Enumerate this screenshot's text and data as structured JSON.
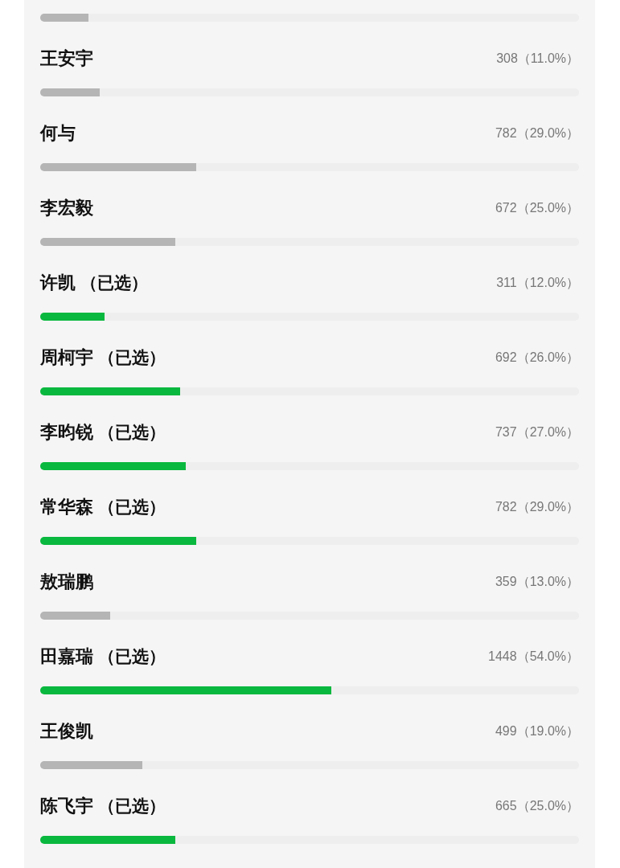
{
  "poll": {
    "options": [
      {
        "selected": false,
        "level": 0.09
      },
      {
        "name": "王安宇",
        "count": "308（11.0%）",
        "selected": false,
        "level": 0.11
      },
      {
        "name": "何与",
        "count": "782（29.0%）",
        "selected": false,
        "level": 0.29
      },
      {
        "name": "李宏毅",
        "count": "672（25.0%）",
        "selected": false,
        "level": 0.25
      },
      {
        "name": "许凯",
        "tag": "（已选）",
        "count": "311（12.0%）",
        "selected": true,
        "level": 0.12
      },
      {
        "name": "周柯宇",
        "tag": "（已选）",
        "count": "692（26.0%）",
        "selected": true,
        "level": 0.26
      },
      {
        "name": "李昀锐",
        "tag": "（已选）",
        "count": "737（27.0%）",
        "selected": true,
        "level": 0.27
      },
      {
        "name": "常华森",
        "tag": "（已选）",
        "count": "782（29.0%）",
        "selected": true,
        "level": 0.29
      },
      {
        "name": "敖瑞鹏",
        "count": "359（13.0%）",
        "selected": false,
        "level": 0.13
      },
      {
        "name": "田嘉瑞",
        "tag": "（已选）",
        "count": "1448（54.0%）",
        "selected": true,
        "level": 0.54
      },
      {
        "name": "王俊凯",
        "count": "499（19.0%）",
        "selected": false,
        "level": 0.19
      },
      {
        "name": "陈飞宇",
        "tag": "（已选）",
        "count": "665（25.0%）",
        "selected": true,
        "level": 0.25
      }
    ]
  }
}
